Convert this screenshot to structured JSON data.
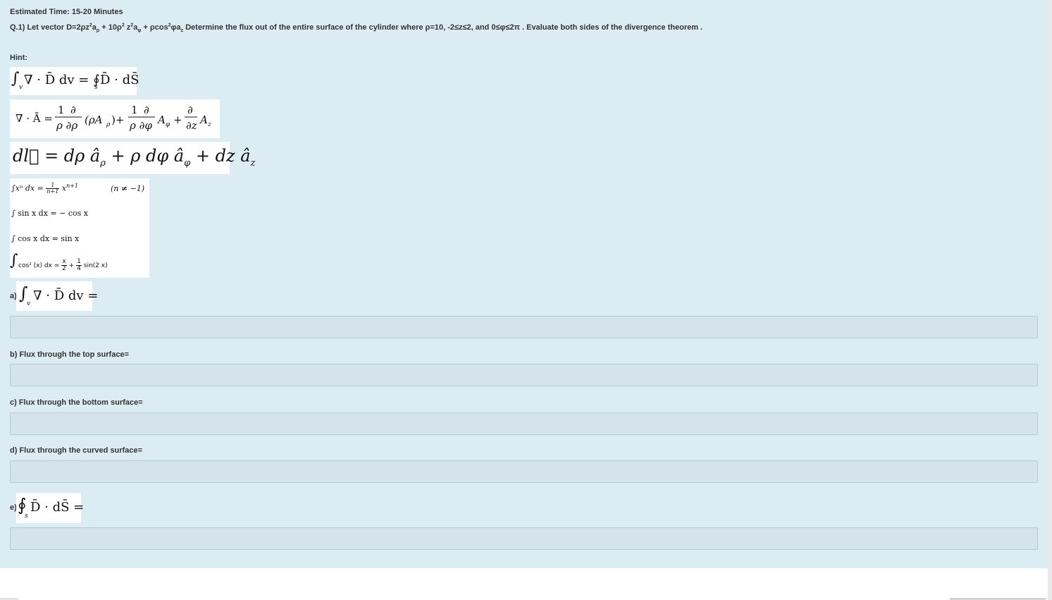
{
  "header": {
    "estimated_time": "Estimated Time: 15-20 Minutes"
  },
  "question": {
    "prefix": "Q.1) Let vector D=2ρz",
    "p1": "a",
    "p1_sub": "ρ",
    "p2": " + 10ρ",
    "p3": " z",
    "p4": "a",
    "p4_sub": "φ",
    "p5": " + ρcos",
    "p6": "φa",
    "p6_sub": "z",
    "suffix": " Determine the flux out of the entire surface of the cylinder where ρ=10, -2≤z≤2, and 0≤φ≤2π . Evaluate both sides of the divergence theorem .",
    "sq": "2"
  },
  "hint": {
    "label": "Hint:"
  },
  "formulas": {
    "div_thm_left": "∫",
    "div_thm_sub_v": "v",
    "div_thm_body": "∇ · D̄ dv = ∮",
    "div_thm_sub_s": "s",
    "div_thm_right": "D̄ · dS̄",
    "divergence_lhs": "∇ · Ā =",
    "dl": "dl⃗ = dρ â",
    "dl_rho": "ρ",
    "dl_mid": " + ρ dφ â",
    "dl_phi": "φ",
    "dl_end": " + dz â",
    "dl_z": "z",
    "int_power": "∫xⁿ dx =",
    "int_power_cond": "(n ≠ −1)",
    "int_sin": "∫ sin x dx = − cos x",
    "int_cos": "∫ cos x dx = sin x",
    "int_cos2": "cos² (x) dx =",
    "int_cos2_end": "sin(2 x)"
  },
  "parts": {
    "a_label": "a)",
    "a_formula": "∇ · D̄ dv =",
    "b_label": "b) Flux through the top surface=",
    "c_label": "c) Flux through the bottom surface=",
    "d_label": "d) Flux through the curved surface=",
    "e_label": "e)",
    "e_formula": "D̄ · dS̄ ="
  },
  "answers": {
    "a": "",
    "b": "",
    "c": "",
    "d": "",
    "e": ""
  },
  "colors": {
    "panel_bg": "#dcecf3",
    "input_bg": "#d5e3ea",
    "input_border": "#b8c9d1"
  }
}
